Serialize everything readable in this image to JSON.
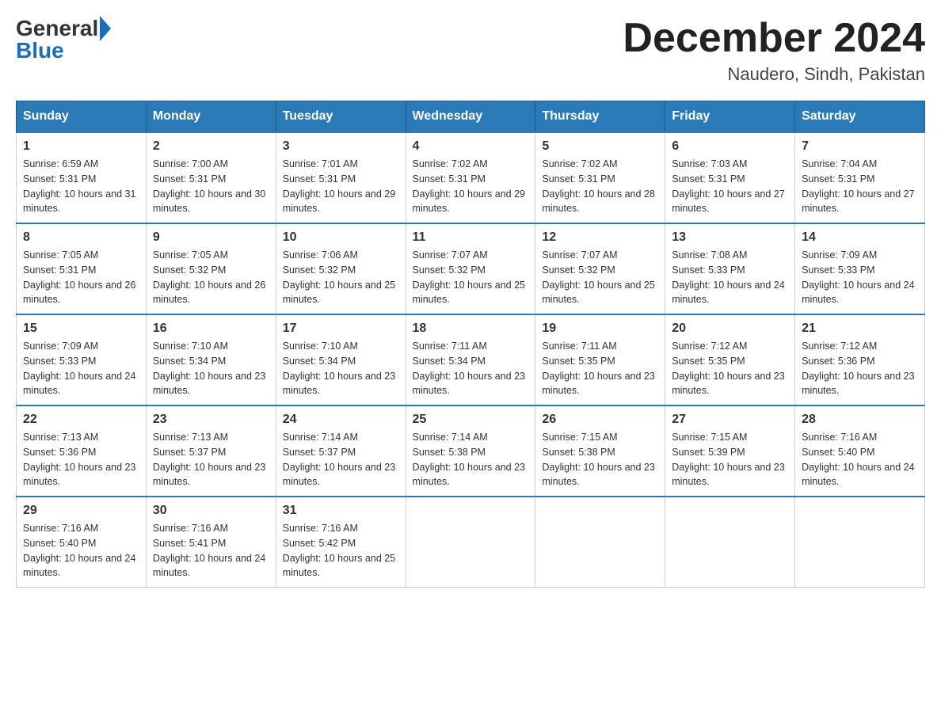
{
  "header": {
    "logo_general": "General",
    "logo_blue": "Blue",
    "month_title": "December 2024",
    "location": "Naudero, Sindh, Pakistan"
  },
  "days_of_week": [
    "Sunday",
    "Monday",
    "Tuesday",
    "Wednesday",
    "Thursday",
    "Friday",
    "Saturday"
  ],
  "weeks": [
    [
      {
        "day": "1",
        "sunrise": "6:59 AM",
        "sunset": "5:31 PM",
        "daylight": "10 hours and 31 minutes."
      },
      {
        "day": "2",
        "sunrise": "7:00 AM",
        "sunset": "5:31 PM",
        "daylight": "10 hours and 30 minutes."
      },
      {
        "day": "3",
        "sunrise": "7:01 AM",
        "sunset": "5:31 PM",
        "daylight": "10 hours and 29 minutes."
      },
      {
        "day": "4",
        "sunrise": "7:02 AM",
        "sunset": "5:31 PM",
        "daylight": "10 hours and 29 minutes."
      },
      {
        "day": "5",
        "sunrise": "7:02 AM",
        "sunset": "5:31 PM",
        "daylight": "10 hours and 28 minutes."
      },
      {
        "day": "6",
        "sunrise": "7:03 AM",
        "sunset": "5:31 PM",
        "daylight": "10 hours and 27 minutes."
      },
      {
        "day": "7",
        "sunrise": "7:04 AM",
        "sunset": "5:31 PM",
        "daylight": "10 hours and 27 minutes."
      }
    ],
    [
      {
        "day": "8",
        "sunrise": "7:05 AM",
        "sunset": "5:31 PM",
        "daylight": "10 hours and 26 minutes."
      },
      {
        "day": "9",
        "sunrise": "7:05 AM",
        "sunset": "5:32 PM",
        "daylight": "10 hours and 26 minutes."
      },
      {
        "day": "10",
        "sunrise": "7:06 AM",
        "sunset": "5:32 PM",
        "daylight": "10 hours and 25 minutes."
      },
      {
        "day": "11",
        "sunrise": "7:07 AM",
        "sunset": "5:32 PM",
        "daylight": "10 hours and 25 minutes."
      },
      {
        "day": "12",
        "sunrise": "7:07 AM",
        "sunset": "5:32 PM",
        "daylight": "10 hours and 25 minutes."
      },
      {
        "day": "13",
        "sunrise": "7:08 AM",
        "sunset": "5:33 PM",
        "daylight": "10 hours and 24 minutes."
      },
      {
        "day": "14",
        "sunrise": "7:09 AM",
        "sunset": "5:33 PM",
        "daylight": "10 hours and 24 minutes."
      }
    ],
    [
      {
        "day": "15",
        "sunrise": "7:09 AM",
        "sunset": "5:33 PM",
        "daylight": "10 hours and 24 minutes."
      },
      {
        "day": "16",
        "sunrise": "7:10 AM",
        "sunset": "5:34 PM",
        "daylight": "10 hours and 23 minutes."
      },
      {
        "day": "17",
        "sunrise": "7:10 AM",
        "sunset": "5:34 PM",
        "daylight": "10 hours and 23 minutes."
      },
      {
        "day": "18",
        "sunrise": "7:11 AM",
        "sunset": "5:34 PM",
        "daylight": "10 hours and 23 minutes."
      },
      {
        "day": "19",
        "sunrise": "7:11 AM",
        "sunset": "5:35 PM",
        "daylight": "10 hours and 23 minutes."
      },
      {
        "day": "20",
        "sunrise": "7:12 AM",
        "sunset": "5:35 PM",
        "daylight": "10 hours and 23 minutes."
      },
      {
        "day": "21",
        "sunrise": "7:12 AM",
        "sunset": "5:36 PM",
        "daylight": "10 hours and 23 minutes."
      }
    ],
    [
      {
        "day": "22",
        "sunrise": "7:13 AM",
        "sunset": "5:36 PM",
        "daylight": "10 hours and 23 minutes."
      },
      {
        "day": "23",
        "sunrise": "7:13 AM",
        "sunset": "5:37 PM",
        "daylight": "10 hours and 23 minutes."
      },
      {
        "day": "24",
        "sunrise": "7:14 AM",
        "sunset": "5:37 PM",
        "daylight": "10 hours and 23 minutes."
      },
      {
        "day": "25",
        "sunrise": "7:14 AM",
        "sunset": "5:38 PM",
        "daylight": "10 hours and 23 minutes."
      },
      {
        "day": "26",
        "sunrise": "7:15 AM",
        "sunset": "5:38 PM",
        "daylight": "10 hours and 23 minutes."
      },
      {
        "day": "27",
        "sunrise": "7:15 AM",
        "sunset": "5:39 PM",
        "daylight": "10 hours and 23 minutes."
      },
      {
        "day": "28",
        "sunrise": "7:16 AM",
        "sunset": "5:40 PM",
        "daylight": "10 hours and 24 minutes."
      }
    ],
    [
      {
        "day": "29",
        "sunrise": "7:16 AM",
        "sunset": "5:40 PM",
        "daylight": "10 hours and 24 minutes."
      },
      {
        "day": "30",
        "sunrise": "7:16 AM",
        "sunset": "5:41 PM",
        "daylight": "10 hours and 24 minutes."
      },
      {
        "day": "31",
        "sunrise": "7:16 AM",
        "sunset": "5:42 PM",
        "daylight": "10 hours and 25 minutes."
      },
      null,
      null,
      null,
      null
    ]
  ]
}
